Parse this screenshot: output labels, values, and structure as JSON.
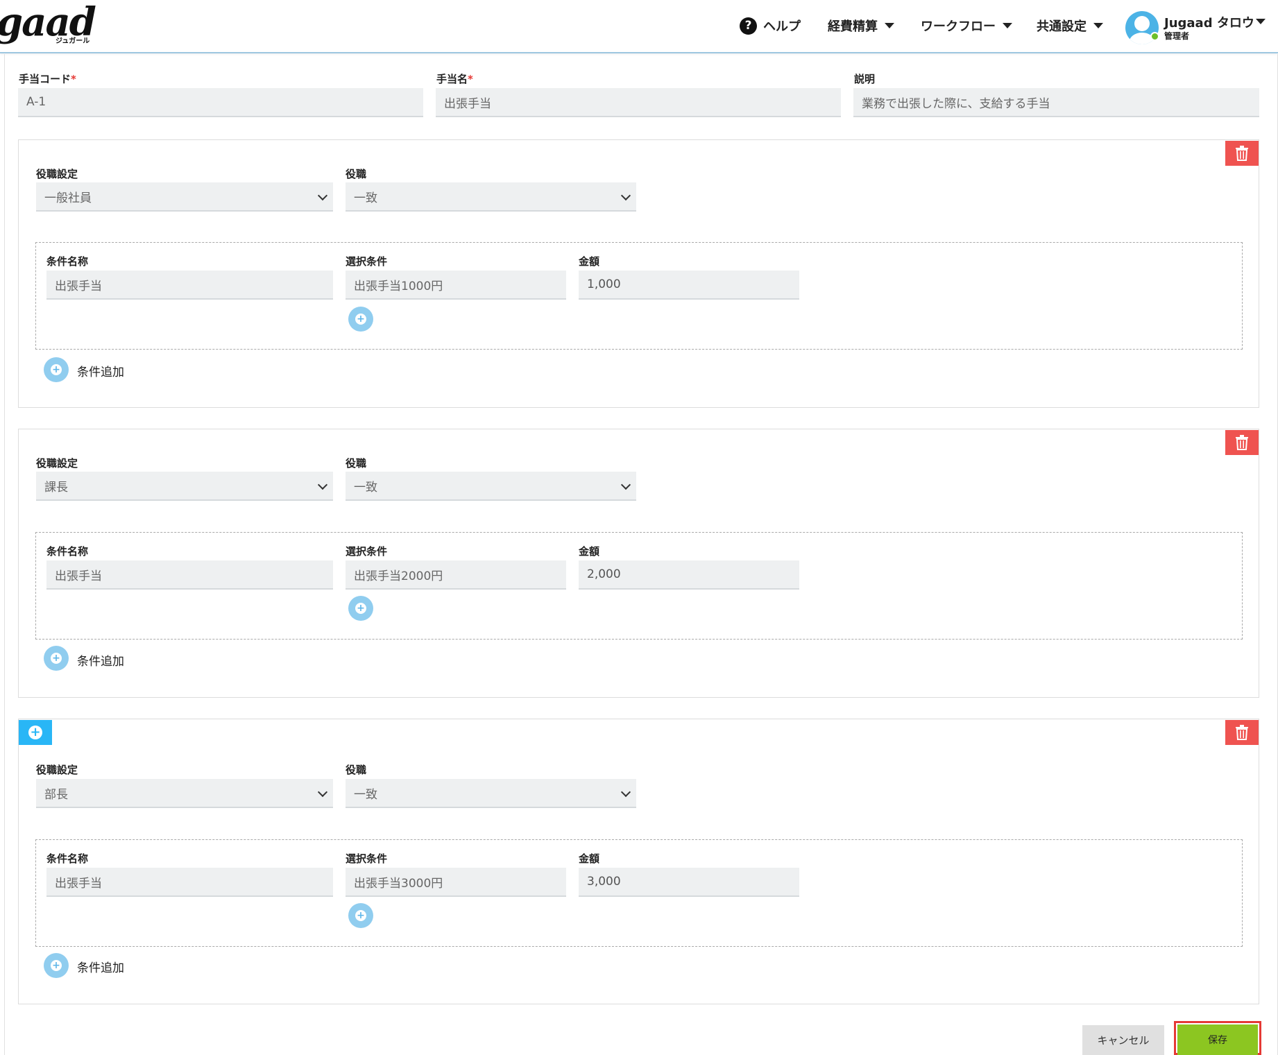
{
  "header": {
    "logo": "gaad",
    "logo_sub": "ジュガール",
    "nav": {
      "help": "ヘルプ",
      "expense": "経費精算",
      "workflow": "ワークフロー",
      "common_settings": "共通設定"
    },
    "user": {
      "name": "Jugaad タロウ",
      "role": "管理者"
    }
  },
  "form": {
    "code_label": "手当コード",
    "code_value": "A-1",
    "name_label": "手当名",
    "name_value": "出張手当",
    "desc_label": "説明",
    "desc_value": "業務で出張した際に、支給する手当",
    "required_mark": "*"
  },
  "labels": {
    "position_setting": "役職設定",
    "position": "役職",
    "condition_name": "条件名称",
    "selection_condition": "選択条件",
    "amount": "金額",
    "add_condition": "条件追加"
  },
  "cards": [
    {
      "position_setting": "一般社員",
      "position": "一致",
      "condition_name": "出張手当",
      "selection_condition": "出張手当1000円",
      "amount": "1,000"
    },
    {
      "position_setting": "課長",
      "position": "一致",
      "condition_name": "出張手当",
      "selection_condition": "出張手当2000円",
      "amount": "2,000"
    },
    {
      "position_setting": "部長",
      "position": "一致",
      "condition_name": "出張手当",
      "selection_condition": "出張手当3000円",
      "amount": "3,000"
    }
  ],
  "buttons": {
    "cancel": "キャンセル",
    "save": "保存"
  },
  "colors": {
    "delete": "#ef5350",
    "add": "#29b6f6",
    "save": "#8cc621",
    "save_highlight": "#e53935"
  }
}
